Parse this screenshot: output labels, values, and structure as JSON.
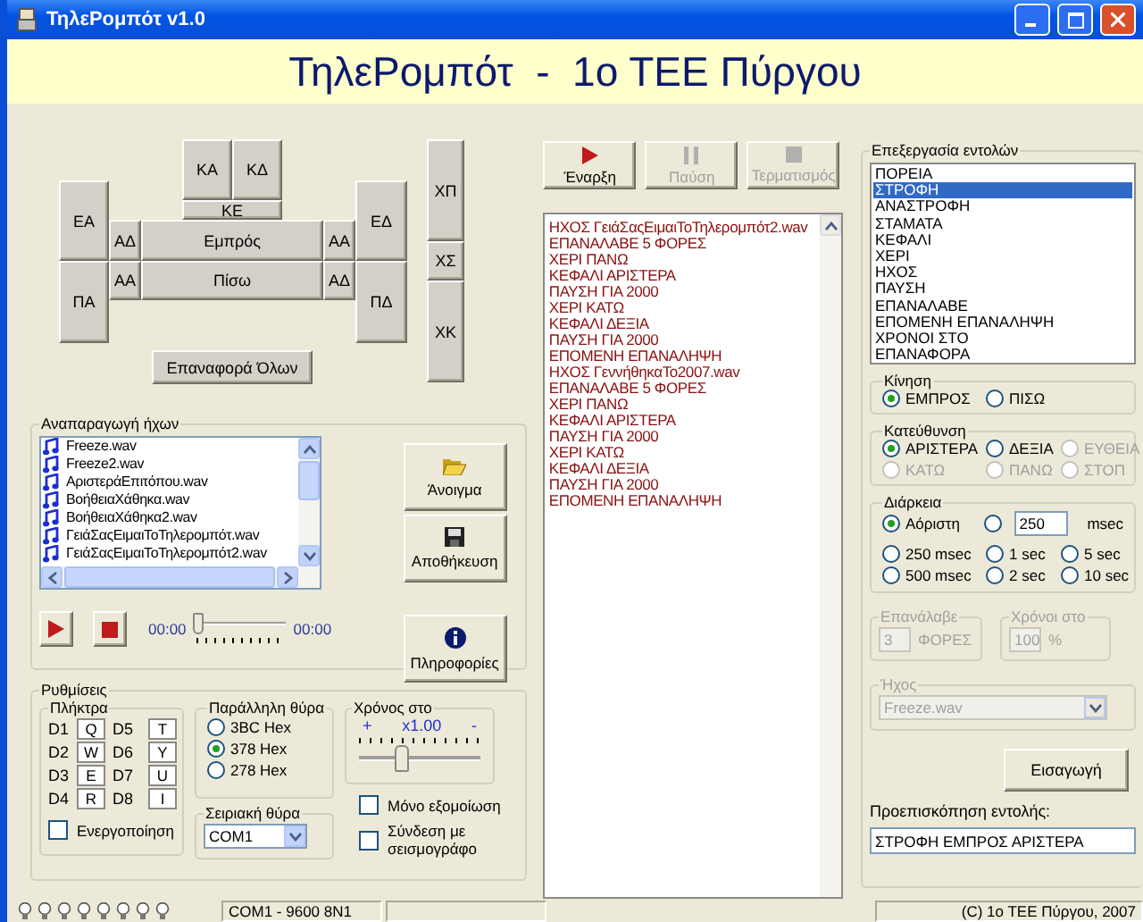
{
  "window": {
    "title": "ΤηλεΡομπότ v1.0"
  },
  "header": {
    "title": "ΤηλεΡομπότ  -  1ο ΤΕΕ Πύργου"
  },
  "pad": {
    "buttons": [
      "ΚΑ",
      "ΚΔ",
      "ΚΕ",
      "ΕΑ",
      "ΑΔ",
      "Εμπρός",
      "ΑΑ",
      "ΕΔ",
      "ΑΑ",
      "Πίσω",
      "ΑΔ",
      "ΠΑ",
      "ΠΔ"
    ],
    "reset": "Επαναφορά Όλων",
    "arm": [
      "ΧΠ",
      "ΧΣ",
      "ΧΚ"
    ]
  },
  "sound": {
    "legend": "Αναπαραγωγή ήχων",
    "files": [
      {
        "label": "Freeze.wav",
        "selected": false
      },
      {
        "label": "Freeze2.wav",
        "selected": false
      },
      {
        "label": "ΑριστεράΕπιτόπου.wav",
        "selected": false
      },
      {
        "label": "ΒοήθειαΧάθηκα.wav",
        "selected": false
      },
      {
        "label": "ΒοήθειαΧάθηκα2.wav",
        "selected": false
      },
      {
        "label": "ΓειάΣαςΕιμαιΤοΤηλερομπότ.wav",
        "selected": false
      },
      {
        "label": "ΓειάΣαςΕιμαιΤοΤηλερομπότ2.wav",
        "selected": false
      }
    ],
    "time_start": "00:00",
    "time_end": "00:00",
    "level": 0
  },
  "file_buttons": [
    {
      "label": "Άνοιγμα",
      "kind": "open"
    },
    {
      "label": "Αποθήκευση",
      "kind": "save"
    },
    {
      "label": "Πληροφορίες",
      "kind": "info"
    }
  ],
  "settings": {
    "legend": "Ρυθμίσεις",
    "keys": {
      "legend": "Πλήκτρα",
      "items": [
        {
          "label": "D1",
          "value": "Q"
        },
        {
          "label": "D5",
          "value": "T"
        },
        {
          "label": "D2",
          "value": "W"
        },
        {
          "label": "D6",
          "value": "Y"
        },
        {
          "label": "D3",
          "value": "E"
        },
        {
          "label": "D7",
          "value": "U"
        },
        {
          "label": "D4",
          "value": "R"
        },
        {
          "label": "D8",
          "value": "I"
        }
      ],
      "enable": {
        "label": "Ενεργοποίηση",
        "checked": false
      }
    },
    "parallel": {
      "legend": "Παράλληλη θύρα",
      "options": [
        {
          "label": "3BC Hex",
          "selected": false
        },
        {
          "label": "378 Hex",
          "selected": true
        },
        {
          "label": "278 Hex",
          "selected": false
        }
      ]
    },
    "serial": {
      "legend": "Σειριακή θύρα",
      "value": "COM1"
    },
    "speed": {
      "legend": "Χρόνος στο",
      "plus": "+",
      "value": "x1.00",
      "minus": "-",
      "level": 0.35
    },
    "checks": [
      {
        "label": "Μόνο εξομοίωση",
        "checked": false
      },
      {
        "label": "Σύνδεση με σεισμογράφο",
        "checked": false
      }
    ]
  },
  "program": {
    "buttons": [
      {
        "label": "Έναρξη",
        "kind": "play",
        "disabled": false
      },
      {
        "label": "Παύση",
        "kind": "pause",
        "disabled": true
      },
      {
        "label": "Τερματισμός",
        "kind": "stop",
        "disabled": true
      }
    ],
    "lines": [
      "ΗΧΟΣ ΓειάΣαςΕιμαιΤοΤηλερομπότ2.wav",
      "ΕΠΑΝΑΛΑΒΕ 5 ΦΟΡΕΣ",
      "ΧΕΡΙ ΠΑΝΩ",
      "ΚΕΦΑΛΙ ΑΡΙΣΤΕΡΑ",
      "ΠΑΥΣΗ ΓΙΑ 2000",
      "ΧΕΡΙ ΚΑΤΩ",
      "ΚΕΦΑΛΙ ΔΕΞΙΑ",
      "ΠΑΥΣΗ ΓΙΑ 2000",
      "ΕΠΟΜΕΝΗ ΕΠΑΝΑΛΗΨΗ",
      "ΗΧΟΣ ΓεννήθηκαΤο2007.wav",
      "ΕΠΑΝΑΛΑΒΕ 5 ΦΟΡΕΣ",
      "ΧΕΡΙ ΠΑΝΩ",
      "ΚΕΦΑΛΙ ΑΡΙΣΤΕΡΑ",
      "ΠΑΥΣΗ ΓΙΑ 2000",
      "ΧΕΡΙ ΚΑΤΩ",
      "ΚΕΦΑΛΙ ΔΕΞΙΑ",
      "ΠΑΥΣΗ ΓΙΑ 2000",
      "ΕΠΟΜΕΝΗ ΕΠΑΝΑΛΗΨΗ"
    ]
  },
  "editor": {
    "legend": "Επεξεργασία εντολών",
    "commands": [
      {
        "label": "ΠΟΡΕΙΑ",
        "selected": false
      },
      {
        "label": "ΣΤΡΟΦΗ",
        "selected": true
      },
      {
        "label": "ΑΝΑΣΤΡΟΦΗ",
        "selected": false
      },
      {
        "label": "ΣΤΑΜΑΤΑ",
        "selected": false
      },
      {
        "label": "ΚΕΦΑΛΙ",
        "selected": false
      },
      {
        "label": "ΧΕΡΙ",
        "selected": false
      },
      {
        "label": "ΗΧΟΣ",
        "selected": false
      },
      {
        "label": "ΠΑΥΣΗ",
        "selected": false
      },
      {
        "label": "ΕΠΑΝΑΛΑΒΕ",
        "selected": false
      },
      {
        "label": "ΕΠΟΜΕΝΗ ΕΠΑΝΑΛΗΨΗ",
        "selected": false
      },
      {
        "label": "ΧΡΟΝΟΙ ΣΤΟ",
        "selected": false
      },
      {
        "label": "ΕΠΑΝΑΦΟΡΑ",
        "selected": false
      }
    ],
    "motion": {
      "legend": "Κίνηση",
      "options": [
        {
          "label": "ΕΜΠΡΟΣ",
          "selected": true,
          "disabled": false
        },
        {
          "label": "ΠΙΣΩ",
          "selected": false,
          "disabled": false
        }
      ]
    },
    "direction": {
      "legend": "Κατεύθυνση",
      "options": [
        {
          "label": "ΑΡΙΣΤΕΡΑ",
          "selected": true,
          "disabled": false
        },
        {
          "label": "ΔΕΞΙΑ",
          "selected": false,
          "disabled": false
        },
        {
          "label": "ΕΥΘΕΙΑ",
          "selected": false,
          "disabled": true
        },
        {
          "label": "ΚΑΤΩ",
          "selected": false,
          "disabled": true
        },
        {
          "label": "ΠΑΝΩ",
          "selected": false,
          "disabled": true
        },
        {
          "label": "ΣΤΟΠ",
          "selected": false,
          "disabled": true
        }
      ]
    },
    "duration": {
      "legend": "Διάρκεια",
      "first": {
        "label": "Αόριστη",
        "selected": true
      },
      "custom": {
        "selected": false,
        "value": "250",
        "unit": "msec"
      },
      "options": [
        {
          "label": "250 msec",
          "selected": false
        },
        {
          "label": "1 sec",
          "selected": false
        },
        {
          "label": "5 sec",
          "selected": false
        },
        {
          "label": "500 msec",
          "selected": false
        },
        {
          "label": "2 sec",
          "selected": false
        },
        {
          "label": "10 sec",
          "selected": false
        }
      ]
    },
    "repeat": {
      "legend": "Επανάλαβε",
      "value": "3",
      "unit": "ΦΟΡΕΣ",
      "disabled": true
    },
    "times": {
      "legend": "Χρόνοι στο",
      "value": "100",
      "unit": "%",
      "disabled": true
    },
    "sound": {
      "legend": "Ήχος",
      "value": "Freeze.wav",
      "disabled": true
    },
    "insert": "Εισαγωγή",
    "preview": {
      "label": "Προεπισκόπηση εντολής:",
      "value": "ΣΤΡΟΦΗ ΕΜΠΡΟΣ ΑΡΙΣΤΕΡΑ"
    }
  },
  "status_bar": {
    "port": "COM1 - 9600 8N1",
    "copyright": "(C) 1ο ΤΕΕ Πύργου, 2007"
  }
}
